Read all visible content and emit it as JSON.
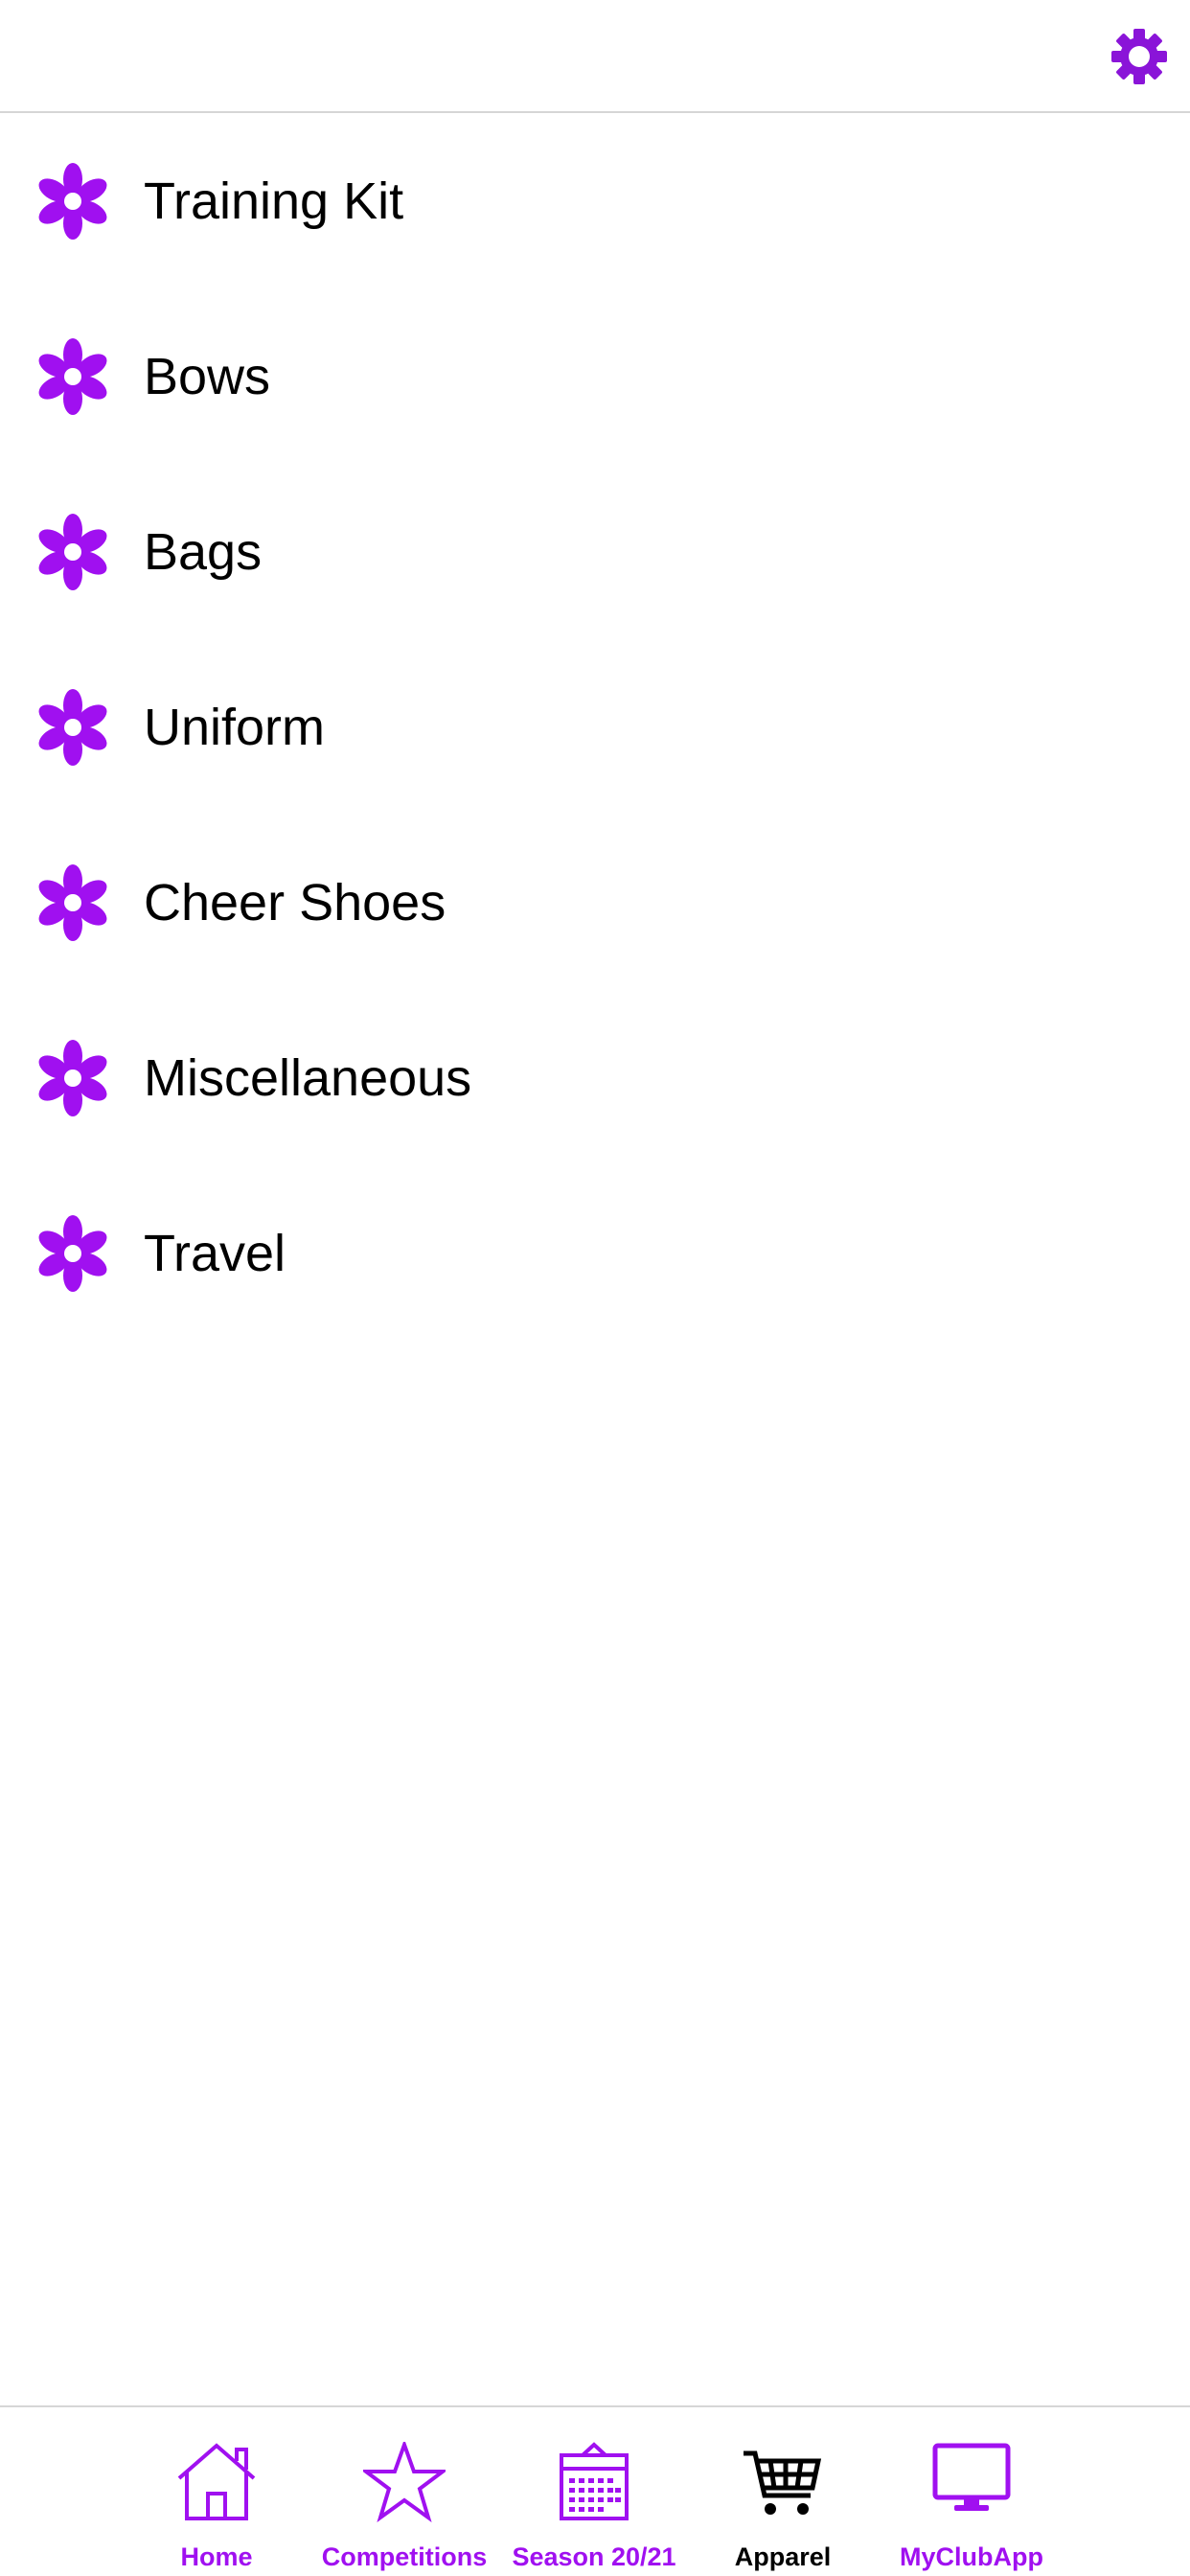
{
  "colors": {
    "accent": "#a010f0",
    "active_tab": "#000000",
    "text": "#000000",
    "divider": "#d6d6d6"
  },
  "header": {
    "settings_icon": "gear-icon"
  },
  "categories": [
    {
      "label": "Training Kit",
      "icon": "flower-icon"
    },
    {
      "label": "Bows",
      "icon": "flower-icon"
    },
    {
      "label": "Bags",
      "icon": "flower-icon"
    },
    {
      "label": "Uniform",
      "icon": "flower-icon"
    },
    {
      "label": "Cheer Shoes",
      "icon": "flower-icon"
    },
    {
      "label": "Miscellaneous",
      "icon": "flower-icon"
    },
    {
      "label": "Travel",
      "icon": "flower-icon"
    }
  ],
  "tabbar": {
    "active": "Apparel",
    "tabs": [
      {
        "label": "Home",
        "icon": "home-icon"
      },
      {
        "label": "Competitions",
        "icon": "star-icon"
      },
      {
        "label": "Season 20/21",
        "icon": "calendar-icon"
      },
      {
        "label": "Apparel",
        "icon": "cart-icon"
      },
      {
        "label": "MyClubApp",
        "icon": "monitor-icon"
      }
    ]
  }
}
